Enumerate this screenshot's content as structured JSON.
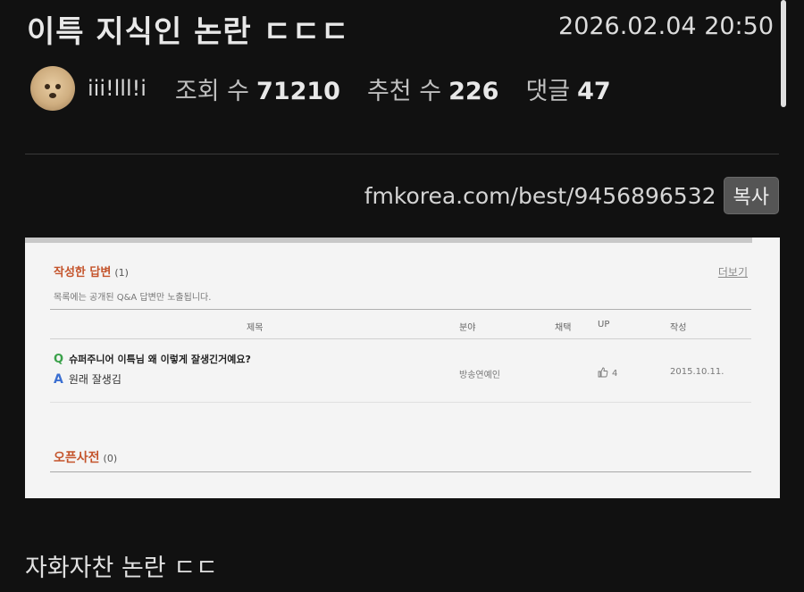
{
  "post": {
    "title": "이특 지식인 논란 ㄷㄷㄷ",
    "datetime": "2026.02.04 20:50",
    "author": "iii!lll!i",
    "views_label": "조회 수",
    "views": "71210",
    "recommend_label": "추천 수",
    "recommend": "226",
    "comments_label": "댓글",
    "comments": "47",
    "url": "fmkorea.com/best/9456896532",
    "copy_label": "복사",
    "body_text": "자화자찬 논란 ㄷㄷ"
  },
  "embedded": {
    "section1_title": "작성한 답변",
    "section1_count": "(1)",
    "more_link": "더보기",
    "note": "목록에는 공개된 Q&A 답변만 노출됩니다.",
    "headers": {
      "title": "제목",
      "category": "분야",
      "adopted": "채택",
      "up": "UP",
      "date": "작성"
    },
    "row": {
      "q_mark": "Q",
      "question": "슈퍼주니어 이특님 왜 이렇게 잘생긴거예요?",
      "a_mark": "A",
      "answer": "원래 잘생김",
      "category": "방송연예인",
      "up": "4",
      "date": "2015.10.11."
    },
    "section2_title": "오픈사전",
    "section2_count": "(0)"
  }
}
